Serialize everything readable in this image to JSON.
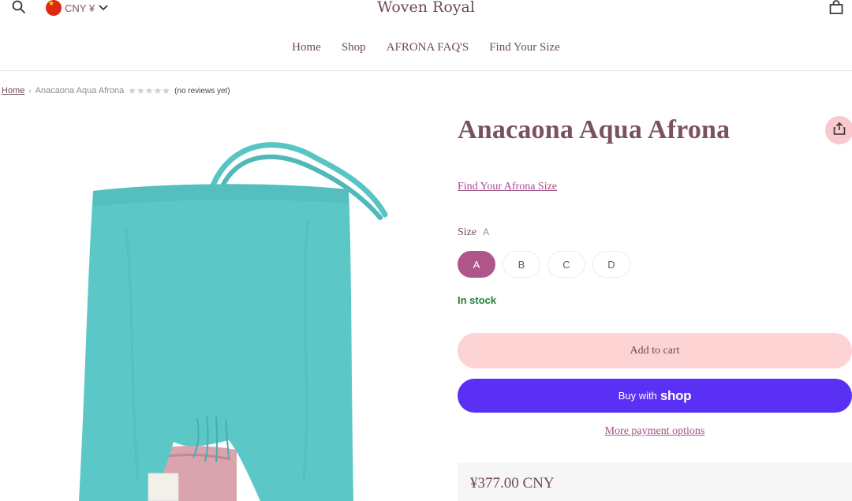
{
  "header": {
    "search_icon": "search-icon",
    "currency": {
      "label": "CNY ¥",
      "flag": "china-flag-icon",
      "chevron": "chevron-down-icon"
    },
    "logo": "Woven Royal",
    "cart_icon": "shopping-bag-icon"
  },
  "nav": {
    "items": [
      "Home",
      "Shop",
      "AFRONA FAQ'S",
      "Find Your Size"
    ]
  },
  "breadcrumb": {
    "home": "Home",
    "separator": "›",
    "current": "Anacaona Aqua Afrona",
    "stars": [
      "★",
      "★",
      "★",
      "★",
      "★"
    ],
    "reviews": "(no reviews yet)"
  },
  "product": {
    "title": "Anacaona Aqua Afrona",
    "size_link": "Find Your Afrona Size",
    "size_label": "Size",
    "selected_size": "A",
    "sizes": [
      "A",
      "B",
      "C",
      "D"
    ],
    "stock": "In stock",
    "add_to_cart": "Add to cart",
    "buy_prefix": "Buy with",
    "buy_brand": "shop",
    "more_payment": "More payment options",
    "price": "¥377.00 CNY"
  },
  "colors": {
    "accent": "#b05589",
    "title": "#7a5160",
    "add_to_cart_bg": "#fdd3d3",
    "shop_pay": "#5a31f4",
    "in_stock": "#1e7c3a",
    "garment": "#5cc7c7"
  }
}
